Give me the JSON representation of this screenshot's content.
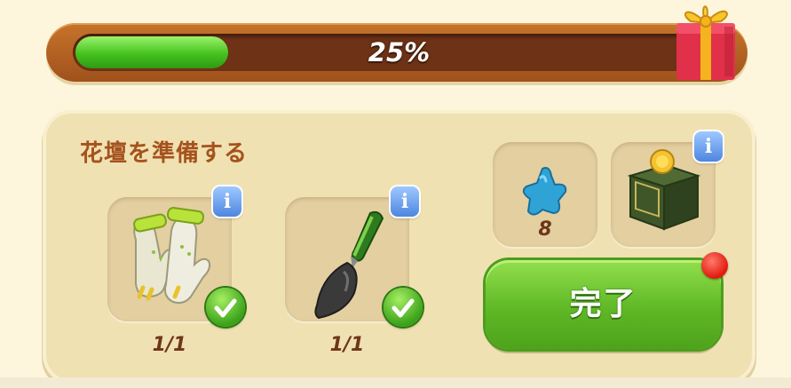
{
  "progress": {
    "percent_label": "25%",
    "fraction": 0.25
  },
  "task": {
    "title": "花壇を準備する"
  },
  "items": [
    {
      "icon": "gloves-icon",
      "count": "1/1",
      "completed": true
    },
    {
      "icon": "trowel-icon",
      "count": "1/1",
      "completed": true
    }
  ],
  "rewards": [
    {
      "icon": "blue-star-icon",
      "value": "8"
    },
    {
      "icon": "coin-box-icon"
    }
  ],
  "info_label": "i",
  "done_button": {
    "label": "完了"
  },
  "colors": {
    "accent_green": "#5fb826",
    "title_brown": "#a5521d",
    "notification_red": "#e0190e"
  }
}
